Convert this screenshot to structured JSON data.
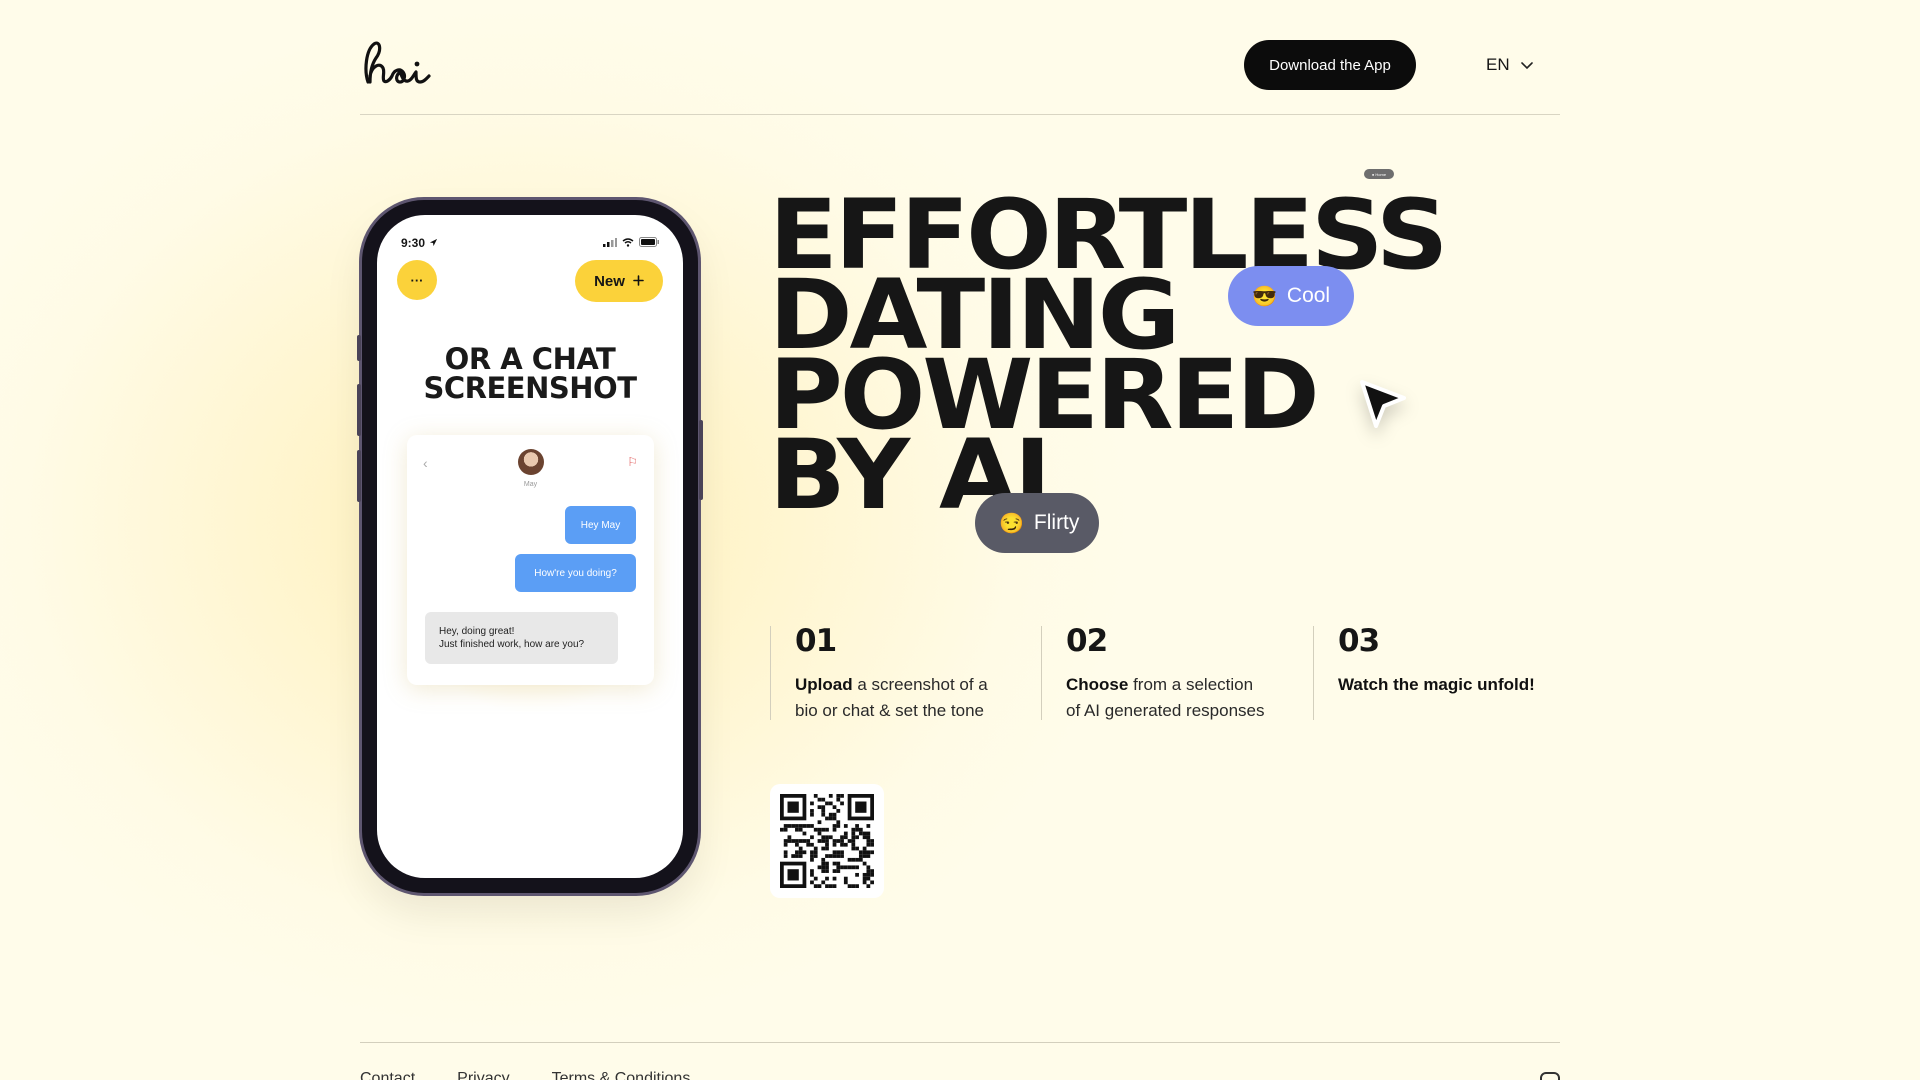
{
  "header": {
    "logo_text": "hai",
    "download_label": "Download the App",
    "language": "EN"
  },
  "phone": {
    "time": "9:30",
    "menu_label": "···",
    "new_label": "New",
    "heading_line1": "OR A CHAT",
    "heading_line2": "SCREENSHOT",
    "chat": {
      "contact_name": "May",
      "messages": [
        {
          "from": "me",
          "text": "Hey May"
        },
        {
          "from": "me",
          "text": "How're you doing?"
        },
        {
          "from": "them",
          "line1": "Hey, doing great!",
          "line2": "Just finished work, how are you?"
        }
      ]
    }
  },
  "hero": {
    "title_lines": [
      "EFFORTLESS",
      "DATING",
      "POWERED",
      "BY AI"
    ],
    "tiny_pill": "● Home",
    "tone_pills": [
      {
        "emoji": "😎",
        "label": "Cool",
        "color": "#7c8ef0"
      },
      {
        "emoji": "😏",
        "label": "Flirty",
        "color": "#595a66"
      }
    ]
  },
  "steps": [
    {
      "number": "01",
      "bold": "Upload",
      "rest_line1": " a screenshot of a",
      "rest_line2": "bio or chat & set the tone"
    },
    {
      "number": "02",
      "bold": "Choose",
      "rest_line1": " from a selection",
      "rest_line2": "of AI generated responses"
    },
    {
      "number": "03",
      "bold": "Watch the magic unfold!",
      "rest_line1": "",
      "rest_line2": ""
    }
  ],
  "footer": {
    "links": [
      "Contact",
      "Privacy",
      "Terms & Conditions"
    ]
  },
  "colors": {
    "background": "#fffbe6",
    "accent_yellow": "#fbd23a",
    "bubble_blue": "#5b9ef5",
    "cool_pill": "#7c8ef0",
    "flirty_pill": "#595a66"
  },
  "icons": [
    "hai-logo",
    "chevron-down-icon",
    "location-arrow-icon",
    "signal-icon",
    "wifi-icon",
    "battery-icon",
    "plus-icon",
    "back-chevron-icon",
    "flag-icon",
    "cursor-arrow-icon",
    "qr-code",
    "instagram-icon"
  ]
}
